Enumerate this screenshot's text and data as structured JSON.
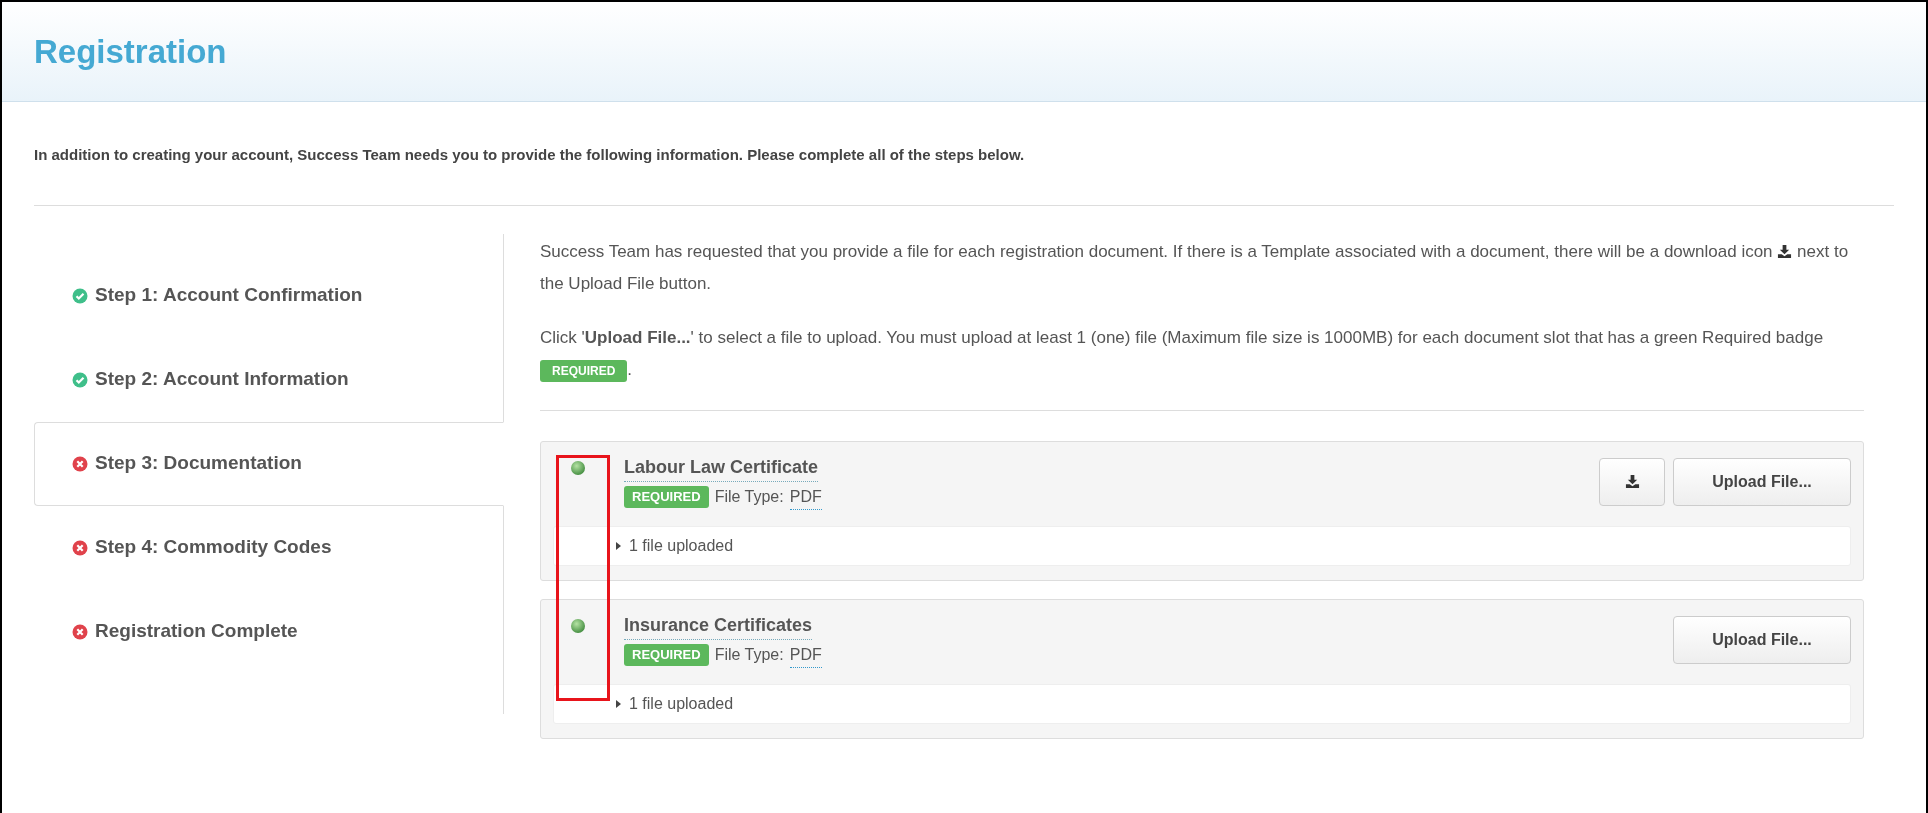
{
  "header": {
    "title": "Registration"
  },
  "intro": "In addition to creating your account, Success Team needs you to provide the following information. Please complete all of the steps below.",
  "steps": [
    {
      "label": "Step 1: Account Confirmation",
      "complete": true,
      "selected": false
    },
    {
      "label": "Step 2: Account Information",
      "complete": true,
      "selected": false
    },
    {
      "label": "Step 3: Documentation",
      "complete": false,
      "selected": true
    },
    {
      "label": "Step 4: Commodity Codes",
      "complete": false,
      "selected": false
    },
    {
      "label": "Registration Complete",
      "complete": false,
      "selected": false
    }
  ],
  "help": {
    "paragraph_1_before": "Success Team has requested that you provide a file for each registration document. If there is a Template associated with a document, there will be a download icon",
    "paragraph_1_after": "next to the Upload File button.",
    "paragraph_2": "Click '**Upload File...**' to select a file to upload. You must upload at least 1 (one) file (Maximum file size is 1000MB) for each document slot that has a green Required badge",
    "badge": "REQUIRED",
    "paragraph_2_end": "."
  },
  "documents": [
    {
      "title": "Labour Law Certificate",
      "badge": "REQUIRED",
      "file_type_label": "File Type:",
      "file_type": "PDF",
      "has_template": true,
      "upload_button": "Upload File...",
      "uploaded": "1 file uploaded",
      "expanded": false
    },
    {
      "title": "Insurance Certificates",
      "badge": "REQUIRED",
      "file_type_label": "File Type:",
      "file_type": "PDF",
      "has_template": false,
      "upload_button": "Upload File...",
      "uploaded": "1 file uploaded",
      "expanded": false
    }
  ]
}
